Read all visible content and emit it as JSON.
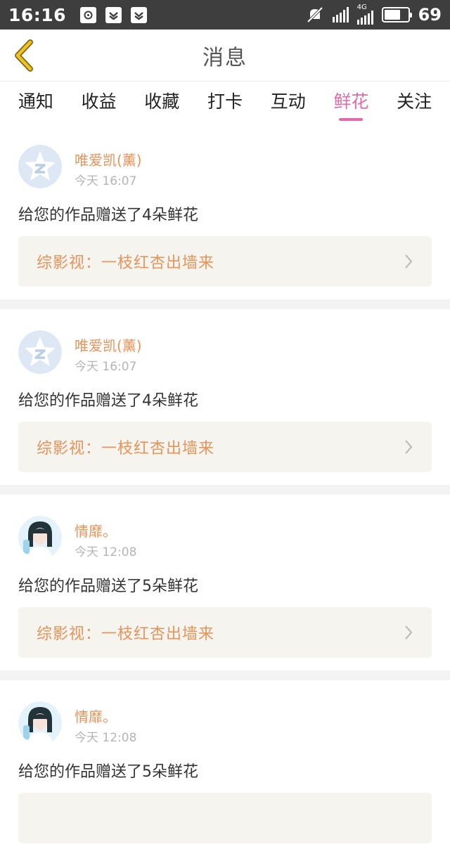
{
  "status_bar": {
    "time": "16:16",
    "network": "4G",
    "battery": "69",
    "battery_level": 0.69
  },
  "header": {
    "title": "消息",
    "back_icon": "chevron-left-icon"
  },
  "tabs": [
    {
      "label": "通知",
      "active": false
    },
    {
      "label": "收益",
      "active": false
    },
    {
      "label": "收藏",
      "active": false
    },
    {
      "label": "打卡",
      "active": false
    },
    {
      "label": "互动",
      "active": false
    },
    {
      "label": "鲜花",
      "active": true
    },
    {
      "label": "关注",
      "active": false
    }
  ],
  "items": [
    {
      "user": "唯爱凯(薰)",
      "time": "今天 16:07",
      "message": "给您的作品赠送了4朵鲜花",
      "work": "综影视：一枝红杏出墙来",
      "avatar": "qzone-default-avatar"
    },
    {
      "user": "唯爱凯(薰)",
      "time": "今天 16:07",
      "message": "给您的作品赠送了4朵鲜花",
      "work": "综影视：一枝红杏出墙来",
      "avatar": "qzone-default-avatar"
    },
    {
      "user": "情靡。",
      "time": "今天 12:08",
      "message": "给您的作品赠送了5朵鲜花",
      "work": "综影视：一枝红杏出墙来",
      "avatar": "girl-photo-avatar"
    },
    {
      "user": "情靡。",
      "time": "今天 12:08",
      "message": "给您的作品赠送了5朵鲜花",
      "work": "",
      "avatar": "girl-photo-avatar"
    }
  ],
  "colors": {
    "accent": "#e06ba8",
    "name": "#e8935a",
    "status_bar": "#3e3e3e",
    "back_icon": "#f2c21b"
  }
}
